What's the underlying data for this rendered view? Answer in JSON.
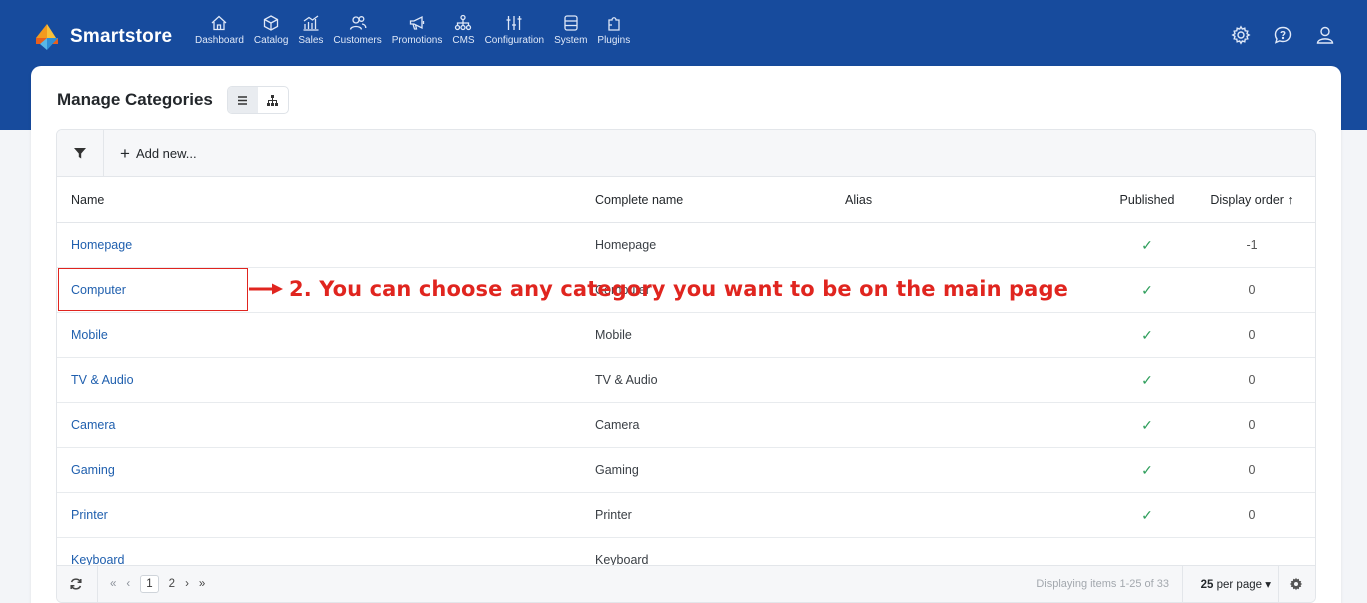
{
  "app": {
    "brand_name": "Smartstore"
  },
  "nav": [
    {
      "label": "Dashboard",
      "icon": "home-icon"
    },
    {
      "label": "Catalog",
      "icon": "box-icon"
    },
    {
      "label": "Sales",
      "icon": "chart-icon"
    },
    {
      "label": "Customers",
      "icon": "users-icon"
    },
    {
      "label": "Promotions",
      "icon": "megaphone-icon"
    },
    {
      "label": "CMS",
      "icon": "sitemap-icon"
    },
    {
      "label": "Configuration",
      "icon": "sliders-icon"
    },
    {
      "label": "System",
      "icon": "database-icon"
    },
    {
      "label": "Plugins",
      "icon": "puzzle-icon"
    }
  ],
  "page": {
    "title": "Manage Categories"
  },
  "toolbar": {
    "add_new": "Add new..."
  },
  "table": {
    "headers": {
      "name": "Name",
      "complete": "Complete name",
      "alias": "Alias",
      "published": "Published",
      "order": "Display order ↑"
    },
    "rows": [
      {
        "name": "Homepage",
        "complete": "Homepage",
        "published": "✓",
        "order": "-1"
      },
      {
        "name": "Computer",
        "complete": "Computer",
        "published": "✓",
        "order": "0"
      },
      {
        "name": "Mobile",
        "complete": "Mobile",
        "published": "✓",
        "order": "0"
      },
      {
        "name": "TV & Audio",
        "complete": "TV & Audio",
        "published": "✓",
        "order": "0"
      },
      {
        "name": "Camera",
        "complete": "Camera",
        "published": "✓",
        "order": "0"
      },
      {
        "name": "Gaming",
        "complete": "Gaming",
        "published": "✓",
        "order": "0"
      },
      {
        "name": "Printer",
        "complete": "Printer",
        "published": "✓",
        "order": "0"
      },
      {
        "name": "Keyboard",
        "complete": "Keyboard",
        "published": "",
        "order": ""
      }
    ]
  },
  "footer": {
    "first": "«",
    "prev": "‹",
    "page1": "1",
    "page2": "2",
    "next": "›",
    "last": "»",
    "display_info": "Displaying items 1-25 of 33",
    "per_page_value": "25",
    "per_page_suffix": " per page",
    "dropdown": "▾"
  },
  "annotation": {
    "text": "2. You can choose any category you want to be on the main page",
    "color": "#e0251f"
  },
  "colors": {
    "topbar": "#174b9d",
    "link": "#1f5fae",
    "check": "#2e9e5b"
  }
}
